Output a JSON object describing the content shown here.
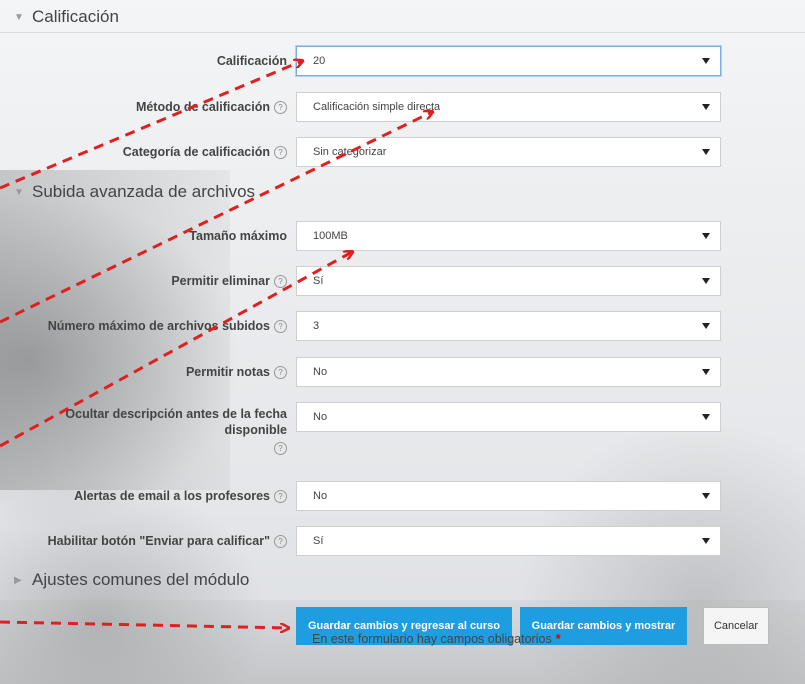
{
  "sections": {
    "calificacion": "Calificación",
    "subida": "Subida avanzada de archivos",
    "ajustes": "Ajustes comunes del módulo"
  },
  "fields": [
    {
      "label": "Calificación",
      "value": "20",
      "help": false
    },
    {
      "label": "Método de calificación",
      "value": "Calificación simple directa",
      "help": true
    },
    {
      "label": "Categoría de calificación",
      "value": "Sin categorizar",
      "help": true
    },
    {
      "label": "Tamaño máximo",
      "value": "100MB",
      "help": false
    },
    {
      "label": "Permitir eliminar",
      "value": "Sí",
      "help": true
    },
    {
      "label": "Número máximo de archivos subidos",
      "value": "3",
      "help": true
    },
    {
      "label": "Permitir notas",
      "value": "No",
      "help": true
    },
    {
      "label_line1": "Ocultar descripción antes de la fecha",
      "label_line2": "disponible",
      "value": "No",
      "help": true
    },
    {
      "label": "Alertas de email a los profesores",
      "value": "No",
      "help": true
    },
    {
      "label": "Habilitar botón \"Enviar para calificar\"",
      "value": "Sí",
      "help": true
    }
  ],
  "buttons": {
    "save_return": "Guardar cambios y regresar al curso",
    "save_show": "Guardar cambios y mostrar",
    "cancel": "Cancelar"
  },
  "required_note": "En este formulario hay campos obligatorios",
  "required_mark": "*",
  "help_glyph": "?",
  "colors": {
    "primary": "#1e9ee0",
    "arrow": "#e02020",
    "required": "#dd0000"
  }
}
